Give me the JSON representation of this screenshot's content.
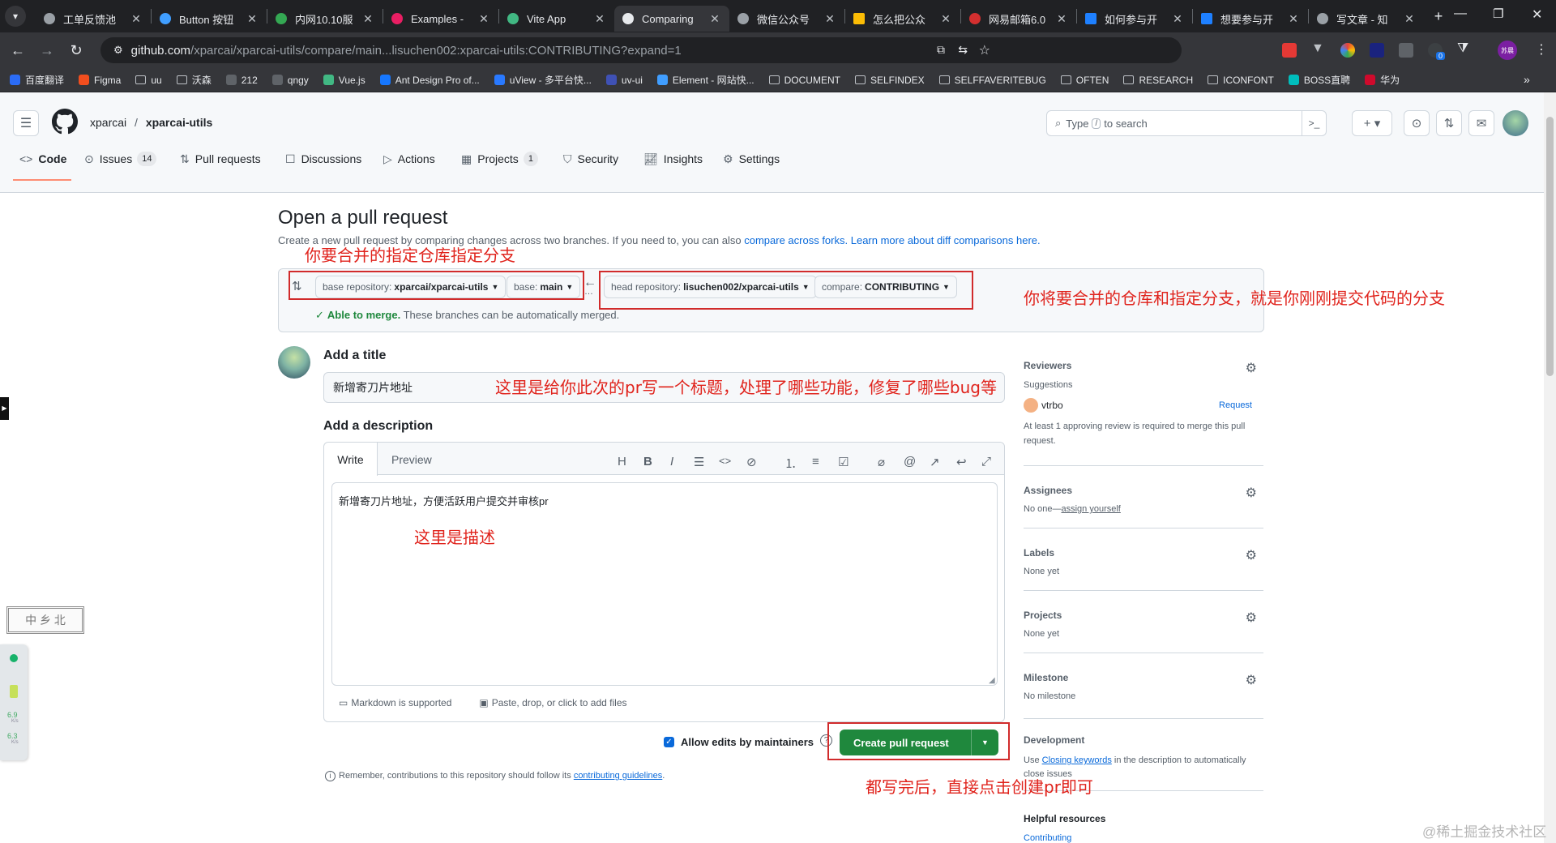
{
  "browser": {
    "tabs": [
      {
        "title": "工单反馈池",
        "active": false
      },
      {
        "title": "Button 按钮",
        "active": false
      },
      {
        "title": "内网10.10服",
        "active": false
      },
      {
        "title": "Examples -",
        "active": false
      },
      {
        "title": "Vite App",
        "active": false
      },
      {
        "title": "Comparing",
        "active": true
      },
      {
        "title": "微信公众号",
        "active": false
      },
      {
        "title": "怎么把公众",
        "active": false
      },
      {
        "title": "网易邮箱6.0",
        "active": false
      },
      {
        "title": "如何参与开",
        "active": false
      },
      {
        "title": "想要参与开",
        "active": false
      },
      {
        "title": "写文章 - 知",
        "active": false
      }
    ],
    "url_domain": "github.com",
    "url_path": "/xparcai/xparcai-utils/compare/main...lisuchen002:xparcai-utils:CONTRIBUTING?expand=1",
    "bookmarks": [
      "百度翻译",
      "Figma",
      "uu",
      "沃森",
      "212",
      "qngy",
      "Vue.js",
      "Ant Design Pro of...",
      "uView - 多平台快...",
      "uv-ui",
      "Element - 网站快...",
      "DOCUMENT",
      "SELFINDEX",
      "SELFFAVERITEBUG",
      "OFTEN",
      "RESEARCH",
      "ICONFONT",
      "BOSS直聘",
      "华为"
    ],
    "ext_badge": "0",
    "profile_label": "苏晨"
  },
  "github": {
    "owner": "xparcai",
    "repo": "xparcai-utils",
    "search_prefix": "Type",
    "search_key": "/",
    "search_suffix": "to search",
    "nav": [
      {
        "label": "Code",
        "count": ""
      },
      {
        "label": "Issues",
        "count": "14"
      },
      {
        "label": "Pull requests",
        "count": ""
      },
      {
        "label": "Discussions",
        "count": ""
      },
      {
        "label": "Actions",
        "count": ""
      },
      {
        "label": "Projects",
        "count": "1"
      },
      {
        "label": "Security",
        "count": ""
      },
      {
        "label": "Insights",
        "count": ""
      },
      {
        "label": "Settings",
        "count": ""
      }
    ]
  },
  "page": {
    "title": "Open a pull request",
    "subtitle": "Create a new pull request by comparing changes across two branches. If you need to, you can also",
    "link_compare": "compare across forks.",
    "link_learn": "Learn more about diff comparisons here.",
    "base_repo_label": "base repository:",
    "base_repo_value": "xparcai/xparcai-utils",
    "base_label": "base:",
    "base_value": "main",
    "head_repo_label": "head repository:",
    "head_repo_value": "lisuchen002/xparcai-utils",
    "compare_label": "compare:",
    "compare_value": "CONTRIBUTING",
    "merge_status_bold": "Able to merge.",
    "merge_status_text": "These branches can be automatically merged.",
    "add_title_label": "Add a title",
    "title_value": "新增寄刀片地址",
    "add_desc_label": "Add a description",
    "tab_write": "Write",
    "tab_preview": "Preview",
    "desc_value": "新增寄刀片地址，方便活跃用户提交并审核pr",
    "markdown_note": "Markdown is supported",
    "attach_note": "Paste, drop, or click to add files",
    "allow_edits_label": "Allow edits by maintainers",
    "create_button": "Create pull request",
    "remember_text": "Remember, contributions to this repository should follow its",
    "guidelines_link": "contributing guidelines",
    "remember_end": "."
  },
  "sidebar": {
    "reviewers": {
      "heading": "Reviewers",
      "suggestions": "Suggestions",
      "user": "vtrbo",
      "request": "Request",
      "note": "At least 1 approving review is required to merge this pull request."
    },
    "assignees": {
      "heading": "Assignees",
      "text": "No one—",
      "link": "assign yourself"
    },
    "labels": {
      "heading": "Labels",
      "text": "None yet"
    },
    "projects": {
      "heading": "Projects",
      "text": "None yet"
    },
    "milestone": {
      "heading": "Milestone",
      "text": "No milestone"
    },
    "development": {
      "heading": "Development",
      "text_before": "Use",
      "link": "Closing keywords",
      "text_after": "in the description to automatically close issues"
    },
    "helpful": {
      "heading": "Helpful resources",
      "link": "Contributing"
    }
  },
  "annotations": {
    "a1": "你要合并的指定仓库指定分支",
    "a2": "你将要合并的仓库和指定分支，就是你刚刚提交代码的分支",
    "a3": "这里是给你此次的pr写一个标题，处理了哪些功能，修复了哪些bug等",
    "a4": "这里是描述",
    "a5": "都写完后，直接点击创建pr即可"
  },
  "widget": {
    "seal": "中 乡 北",
    "speed_up": "6.9",
    "speed_down": "6.3",
    "unit": "K/s"
  },
  "watermark": "@稀土掘金技术社区",
  "colors": {
    "accent": "#0969da",
    "green": "#1f883d",
    "annotation": "#e0231c"
  }
}
